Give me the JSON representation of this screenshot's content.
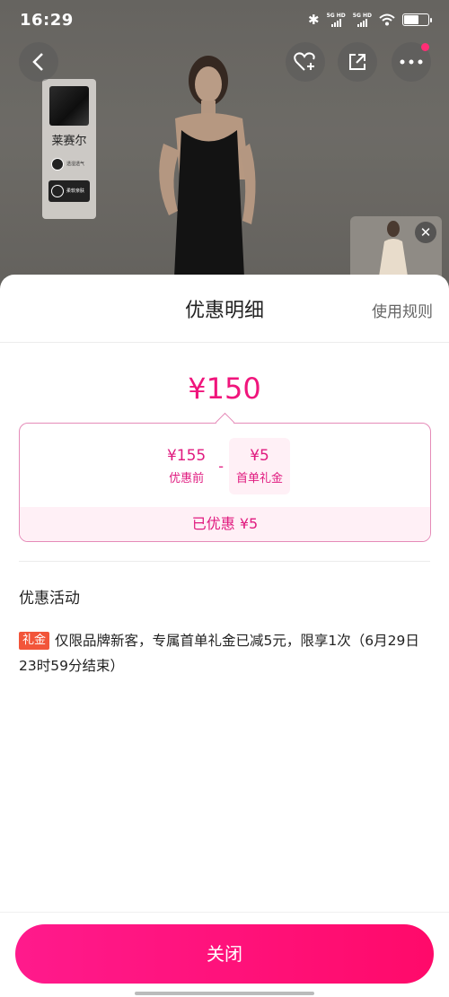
{
  "status_bar": {
    "time": "16:29",
    "network_1": "5G HD",
    "network_2": "5G HD"
  },
  "product": {
    "fabric_name": "莱赛尔",
    "feature_1": "透湿透气",
    "feature_2": "柔软亲肤"
  },
  "sheet": {
    "title": "优惠明细",
    "rules_link": "使用规则",
    "final_price": "¥150",
    "calc": {
      "original_amount": "¥155",
      "original_caption": "优惠前",
      "operator": "-",
      "coupon_amount": "¥5",
      "coupon_caption": "首单礼金"
    },
    "saved_text": "已优惠 ¥5",
    "section_title": "优惠活动",
    "promo": {
      "tag": "礼金",
      "text": "仅限品牌新客，专属首单礼金已减5元，限享1次（6月29日23时59分结束）"
    },
    "close_button": "关闭"
  },
  "colors": {
    "accent": "#f0157c",
    "tag": "#f2553a",
    "button": "#ff1a8c"
  }
}
